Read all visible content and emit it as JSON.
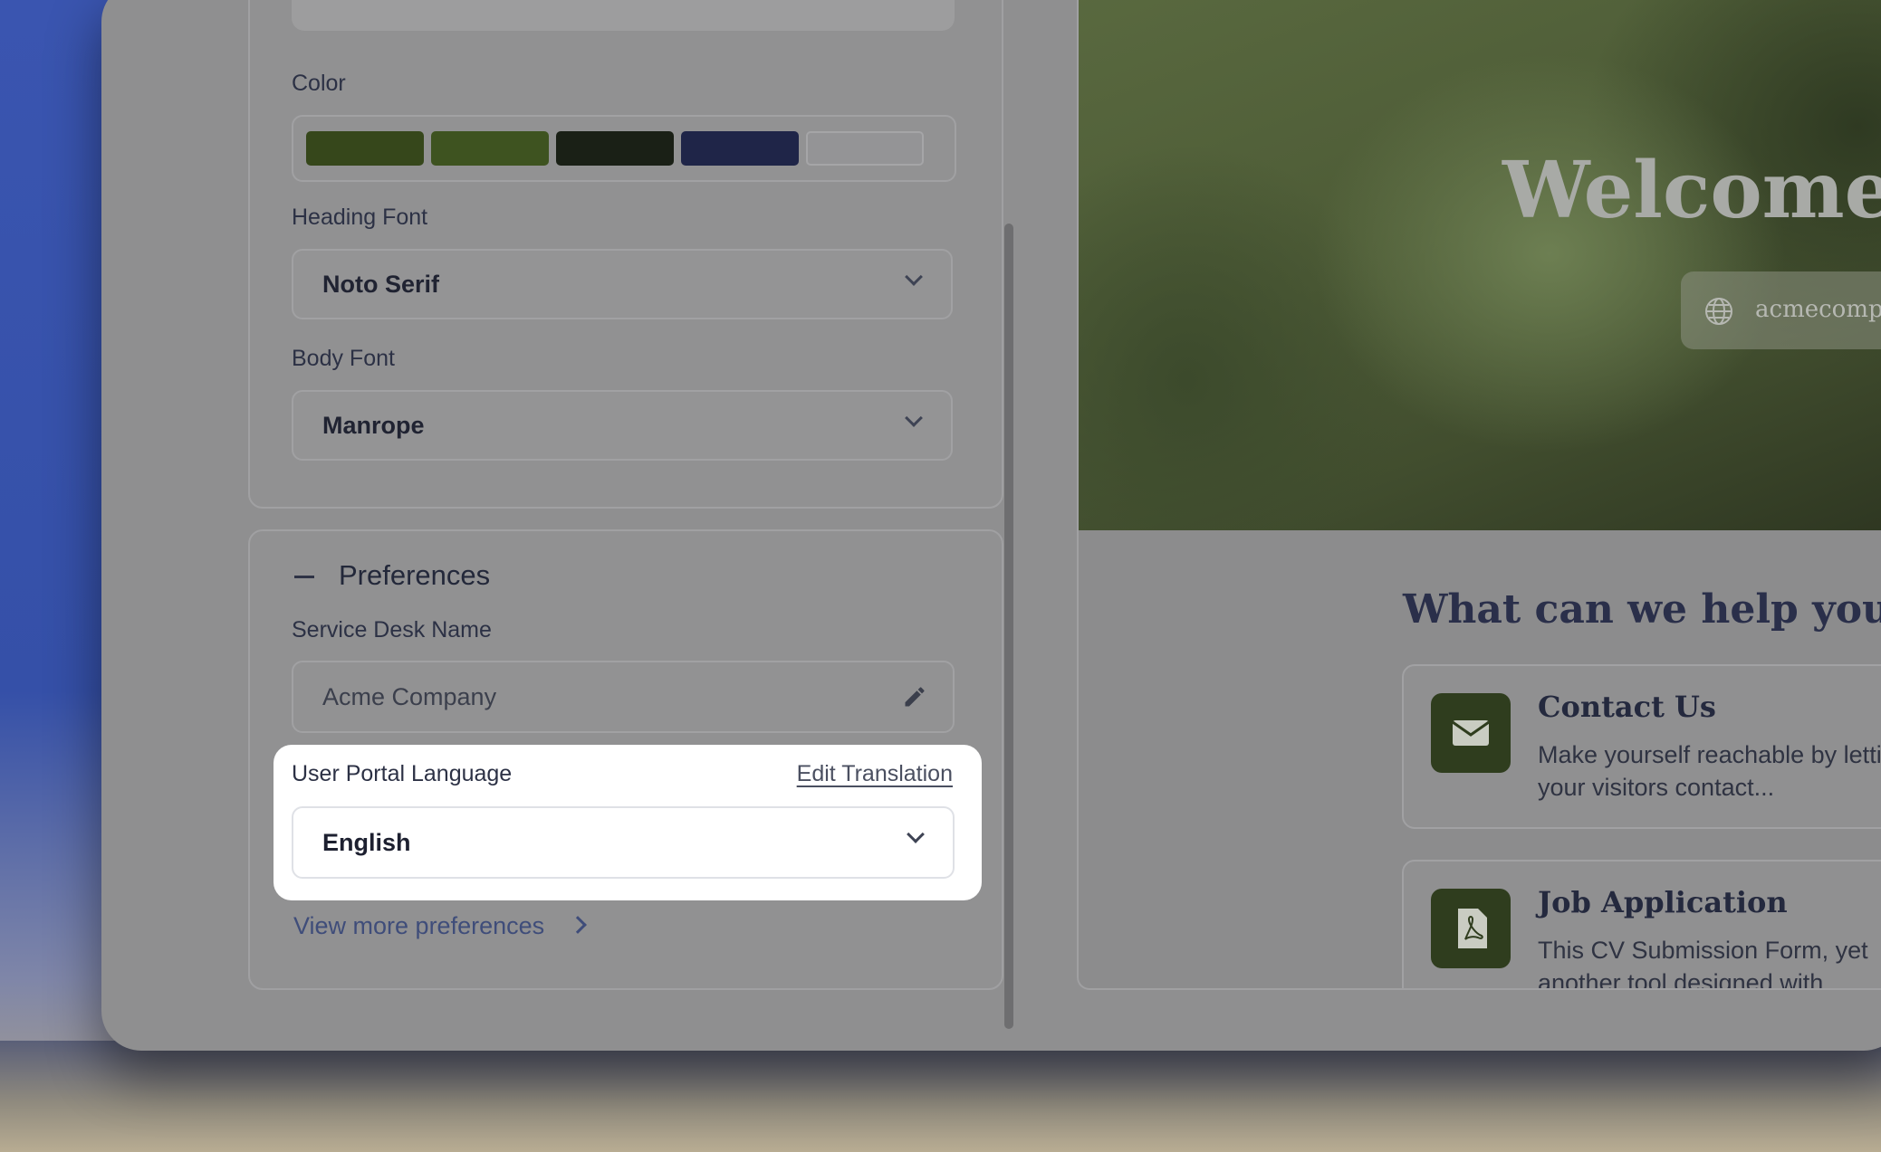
{
  "settings": {
    "color_label": "Color",
    "colors": [
      "#36471b",
      "#3e5320",
      "#1a2016",
      "#1f2548",
      "#949496"
    ],
    "heading_font_label": "Heading Font",
    "heading_font_value": "Noto Serif",
    "body_font_label": "Body Font",
    "body_font_value": "Manrope"
  },
  "preferences": {
    "title": "Preferences",
    "service_desk_label": "Service Desk Name",
    "service_desk_value": "Acme Company",
    "language_label": "User Portal Language",
    "edit_translation": "Edit Translation",
    "language_value": "English",
    "view_more": "View more preferences"
  },
  "preview": {
    "hero_title": "Welcome to our",
    "url": "acmecompany.com",
    "help_title": "What can we help you with?",
    "cards": [
      {
        "title": "Contact Us",
        "desc": "Make yourself reachable by letting your visitors contact...",
        "icon": "envelope-icon"
      },
      {
        "title": "Job Application",
        "desc": "This CV Submission Form, yet another tool designed with...",
        "icon": "pdf-file-icon"
      }
    ]
  }
}
